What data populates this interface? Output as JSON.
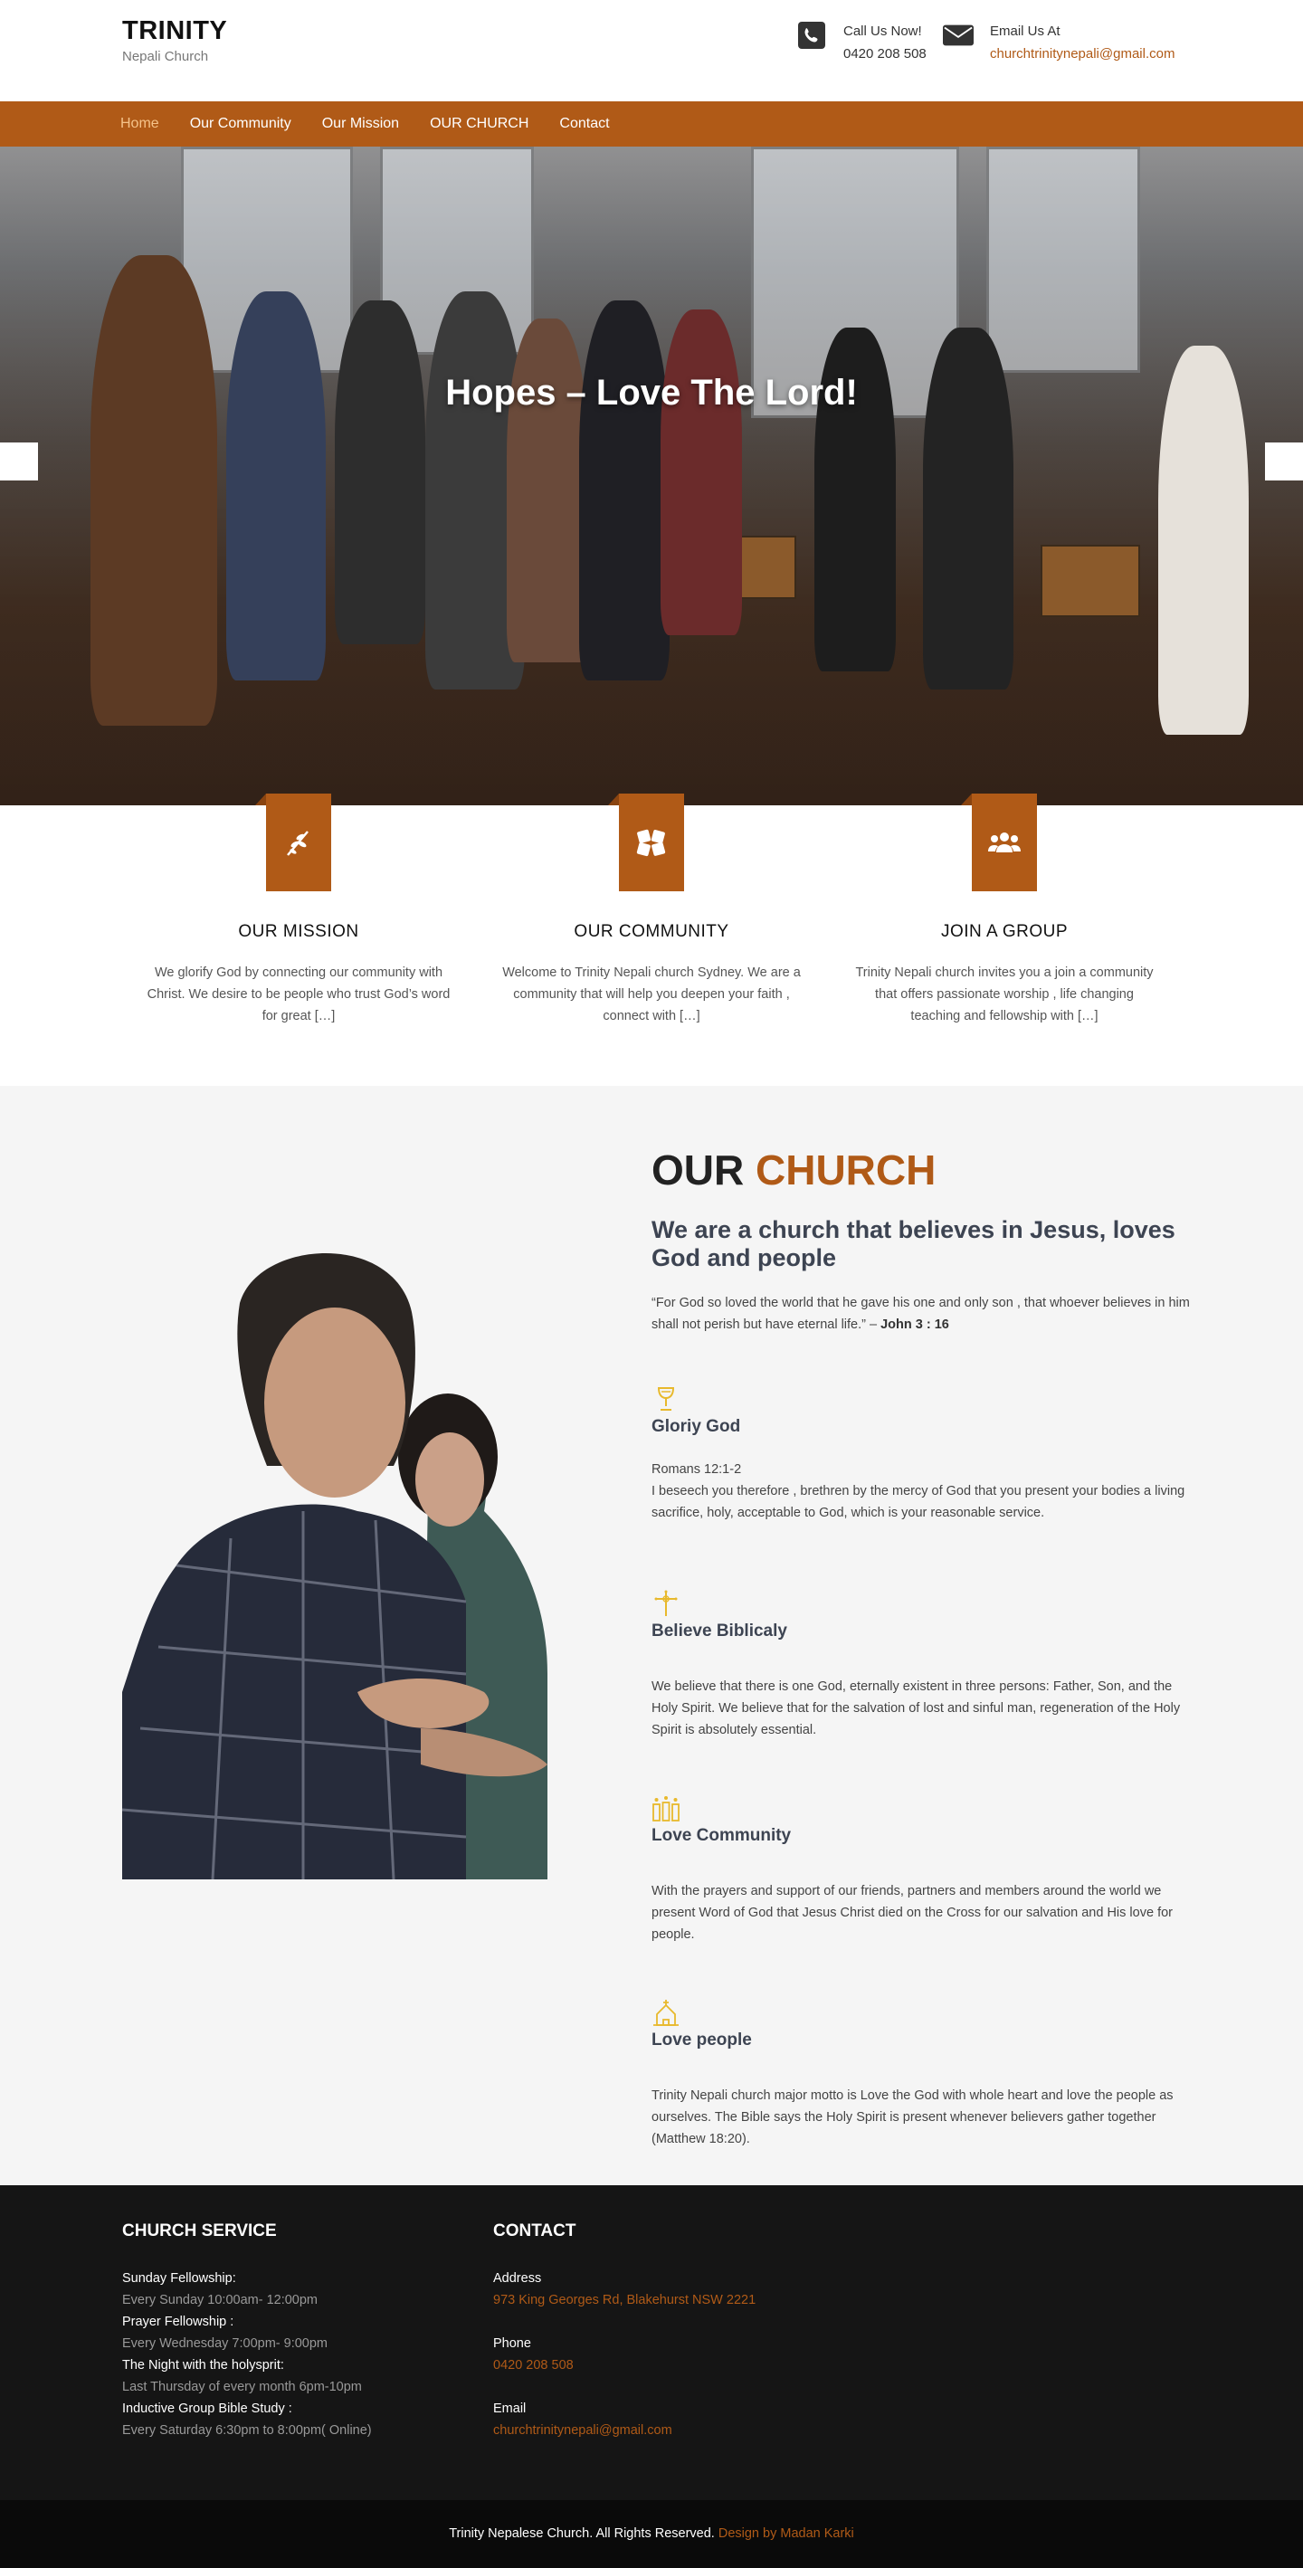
{
  "header": {
    "logo_title": "TRINITY",
    "logo_subtitle": "Nepali Church",
    "call_label": "Call Us Now!",
    "call_value": "0420 208 508",
    "email_label": "Email Us At",
    "email_value": "churchtrinitynepali@gmail.com"
  },
  "nav": {
    "items": [
      "Home",
      "Our Community",
      "Our Mission",
      "OUR CHURCH",
      "Contact"
    ],
    "active": "Home"
  },
  "hero": {
    "title": "Hopes – Love The Lord!"
  },
  "features": [
    {
      "title": "OUR MISSION",
      "text": "We glorify God by connecting our community with Christ. We desire to be people who trust God’s word for great […]",
      "icon": "olive-branch-icon"
    },
    {
      "title": "OUR COMMUNITY",
      "text": "Welcome to Trinity Nepali church Sydney. We are a community that will help you deepen your faith , connect with […]",
      "icon": "hands-icon"
    },
    {
      "title": "JOIN A GROUP",
      "text": "Trinity Nepali church invites you a join a community that offers passionate worship , life changing teaching and fellowship with […]",
      "icon": "group-icon"
    }
  ],
  "church": {
    "heading_part1": "OUR",
    "heading_part2": "CHURCH",
    "subheading": "We are a church that believes in Jesus, loves God and people",
    "quote": "“For God so loved the world that he gave his one and only son , that whoever believes in him shall not perish but have eternal life.”  –",
    "quote_ref": "John 3 : 16",
    "beliefs": [
      {
        "title": "Gloriy God",
        "ref": "Romans 12:1-2",
        "text": "I beseech you therefore , brethren by the mercy of God that you present your bodies a living sacrifice, holy, acceptable to God, which is your reasonable service.",
        "icon": "chalice-icon"
      },
      {
        "title": "Believe Biblicaly",
        "text": "We believe that there is one God, eternally existent in three persons: Father, Son, and the Holy Spirit. We believe that for the salvation of lost and sinful man, regeneration of the Holy Spirit is absolutely essential.",
        "icon": "cross-icon"
      },
      {
        "title": "Love Community",
        "text": "With the prayers and support of our friends, partners and members around the world we present Word of God that Jesus Christ died on the Cross for our salvation and His love for people.",
        "icon": "candles-icon"
      },
      {
        "title": "Love people",
        "text": "Trinity Nepali church major motto is Love the God with whole heart and love the people as ourselves. The Bible says the Holy Spirit is present whenever believers gather together (Matthew 18:20).",
        "icon": "church-icon"
      }
    ]
  },
  "footer": {
    "service_title": "CHURCH SERVICE",
    "services": [
      {
        "label": "Sunday Fellowship:",
        "value": "Every Sunday 10:00am- 12:00pm"
      },
      {
        "label": "Prayer Fellowship :",
        "value": "Every Wednesday 7:00pm- 9:00pm"
      },
      {
        "label": "The Night with the holysprit:",
        "value": "Last Thursday of every month 6pm-10pm"
      },
      {
        "label": "Inductive Group Bible Study :",
        "value": "Every Saturday  6:30pm to 8:00pm( Online)"
      }
    ],
    "contact_title": "CONTACT",
    "address_label": "Address",
    "address_value": "973 King Georges Rd, Blakehurst NSW 2221",
    "phone_label": "Phone",
    "phone_value": "0420 208 508",
    "email_label": "Email",
    "email_value": "churchtrinitynepali@gmail.com",
    "copyright": "Trinity Nepalese Church. All Rights Reserved.",
    "credit": "Design by Madan Karki"
  },
  "colors": {
    "brand": "#b05a17",
    "footer_bg": "#151515",
    "section_bg": "#f5f5f5",
    "icon_gold": "#e8b92c"
  }
}
